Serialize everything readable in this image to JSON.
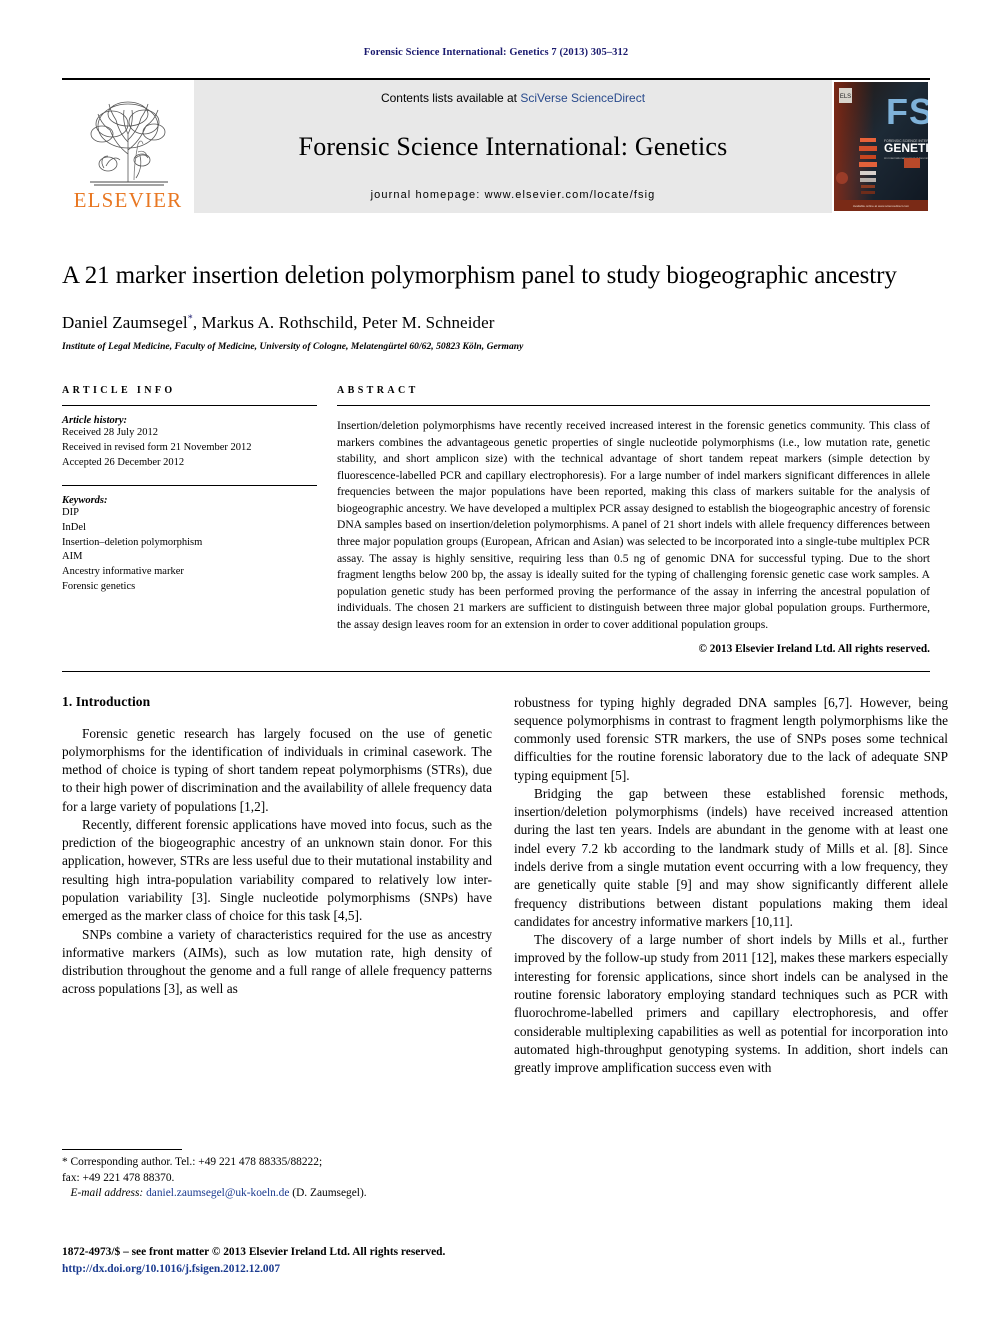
{
  "running_head": "Forensic Science International: Genetics 7 (2013) 305–312",
  "masthead": {
    "publisher_name": "ELSEVIER",
    "contents_prefix": "Contents lists available at ",
    "contents_link": "SciVerse ScienceDirect",
    "journal_title": "Forensic Science International: Genetics",
    "homepage": "journal homepage: www.elsevier.com/locate/fsig",
    "cover_fsi": "FSI",
    "cover_genetics": "GENETICS"
  },
  "article": {
    "title": "A 21 marker insertion deletion polymorphism panel to study biogeographic ancestry",
    "authors": "Daniel Zaumsegel , Markus A. Rothschild, Peter M. Schneider",
    "author_1": "Daniel Zaumsegel",
    "author_rest": ", Markus A. Rothschild, Peter M. Schneider",
    "corresponding_marker": "*",
    "affiliation": "Institute of Legal Medicine, Faculty of Medicine, University of Cologne, Melatengürtel 60/62, 50823 Köln, Germany"
  },
  "article_info": {
    "heading": "ARTICLE INFO",
    "history_heading": "Article history:",
    "history": [
      "Received 28 July 2012",
      "Received in revised form 21 November 2012",
      "Accepted 26 December 2012"
    ],
    "keywords_heading": "Keywords:",
    "keywords": [
      "DIP",
      "InDel",
      "Insertion–deletion polymorphism",
      "AIM",
      "Ancestry informative marker",
      "Forensic genetics"
    ]
  },
  "abstract": {
    "heading": "ABSTRACT",
    "text": "Insertion/deletion polymorphisms have recently received increased interest in the forensic genetics community. This class of markers combines the advantageous genetic properties of single nucleotide polymorphisms (i.e., low mutation rate, genetic stability, and short amplicon size) with the technical advantage of short tandem repeat markers (simple detection by fluorescence-labelled PCR and capillary electrophoresis). For a large number of indel markers significant differences in allele frequencies between the major populations have been reported, making this class of markers suitable for the analysis of biogeographic ancestry. We have developed a multiplex PCR assay designed to establish the biogeographic ancestry of forensic DNA samples based on insertion/deletion polymorphisms. A panel of 21 short indels with allele frequency differences between three major population groups (European, African and Asian) was selected to be incorporated into a single-tube multiplex PCR assay. The assay is highly sensitive, requiring less than 0.5 ng of genomic DNA for successful typing. Due to the short fragment lengths below 200 bp, the assay is ideally suited for the typing of challenging forensic genetic case work samples. A population genetic study has been performed proving the performance of the assay in inferring the ancestral population of individuals. The chosen 21 markers are sufficient to distinguish between three major global population groups. Furthermore, the assay design leaves room for an extension in order to cover additional population groups.",
    "copyright": "© 2013 Elsevier Ireland Ltd. All rights reserved."
  },
  "introduction": {
    "section_title": "1. Introduction",
    "left_paragraphs": [
      "Forensic genetic research has largely focused on the use of genetic polymorphisms for the identification of individuals in criminal casework. The method of choice is typing of short tandem repeat polymorphisms (STRs), due to their high power of discrimination and the availability of allele frequency data for a large variety of populations [1,2].",
      "Recently, different forensic applications have moved into focus, such as the prediction of the biogeographic ancestry of an unknown stain donor. For this application, however, STRs are less useful due to their mutational instability and resulting high intra-population variability compared to relatively low inter-population variability [3]. Single nucleotide polymorphisms (SNPs) have emerged as the marker class of choice for this task [4,5].",
      "SNPs combine a variety of characteristics required for the use as ancestry informative markers (AIMs), such as low mutation rate, high density of distribution throughout the genome and a full range of allele frequency patterns across populations [3], as well as"
    ],
    "right_paragraphs": [
      "robustness for typing highly degraded DNA samples [6,7]. However, being sequence polymorphisms in contrast to fragment length polymorphisms like the commonly used forensic STR markers, the use of SNPs poses some technical difficulties for the routine forensic laboratory due to the lack of adequate SNP typing equipment [5].",
      "Bridging the gap between these established forensic methods, insertion/deletion polymorphisms (indels) have received increased attention during the last ten years. Indels are abundant in the genome with at least one indel every 7.2 kb according to the landmark study of Mills et al. [8]. Since indels derive from a single mutation event occurring with a low frequency, they are genetically quite stable [9] and may show significantly different allele frequency distributions between distant populations making them ideal candidates for ancestry informative markers [10,11].",
      "The discovery of a large number of short indels by Mills et al., further improved by the follow-up study from 2011 [12], makes these markers especially interesting for forensic applications, since short indels can be analysed in the routine forensic laboratory employing standard techniques such as PCR with fluorochrome-labelled primers and capillary electrophoresis, and offer considerable multiplexing capabilities as well as potential for incorporation into automated high-throughput genotyping systems. In addition, short indels can greatly improve amplification success even with"
    ]
  },
  "footnotes": {
    "corresponding": "* Corresponding author. Tel.: +49 221 478 88335/88222;",
    "fax": "fax: +49 221 478 88370.",
    "email_label": "E-mail address:",
    "email": "daniel.zaumsegel@uk-koeln.de",
    "email_suffix": " (D. Zaumsegel).",
    "imprint": "1872-4973/$ – see front matter © 2013 Elsevier Ireland Ltd. All rights reserved.",
    "doi": "http://dx.doi.org/10.1016/j.fsigen.2012.12.007"
  },
  "colors": {
    "elsevier_orange": "#E87722",
    "link_blue": "#1a3a8f",
    "running_head_blue": "#1a1a6e",
    "masthead_gray": "#e8e8e8"
  }
}
